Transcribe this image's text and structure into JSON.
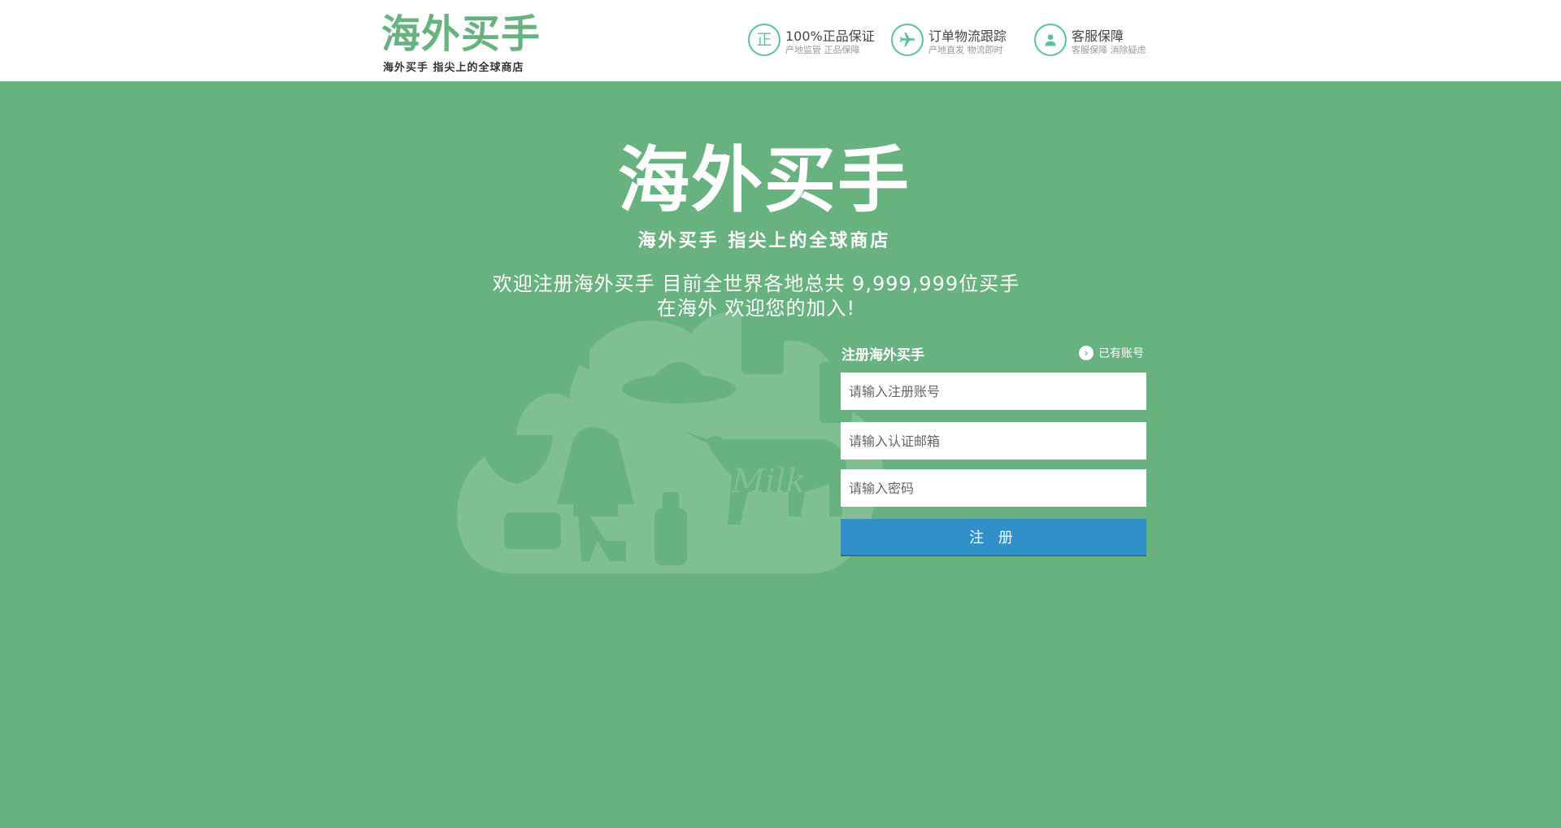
{
  "header": {
    "logo_title": "海外买手",
    "logo_subtitle": "海外买手 指尖上的全球商店",
    "features": [
      {
        "icon": "genuine-icon",
        "icon_text": "正",
        "title": "100%正品保证",
        "subtitle": "产地监管  正品保障"
      },
      {
        "icon": "airplane-icon",
        "title": "订单物流跟踪",
        "subtitle": "产地直发 物流即时"
      },
      {
        "icon": "user-icon",
        "title": "客服保障",
        "subtitle": "客服保障 消除疑虑"
      }
    ]
  },
  "main": {
    "logo_title": "海外买手",
    "logo_subtitle": "海外买手 指尖上的全球商店",
    "welcome_line1": "欢迎注册海外买手 目前全世界各地总共 9,999,999位买手",
    "welcome_line2": "在海外 欢迎您的加入!",
    "cloud_text": "Milk"
  },
  "form": {
    "title": "注册海外买手",
    "login_link": "已有账号",
    "account_placeholder": "请输入注册账号",
    "email_placeholder": "请输入认证邮箱",
    "password_placeholder": "请输入密码",
    "submit_label": "注 册"
  },
  "colors": {
    "brand_green": "#67b27e",
    "icon_teal": "#5cc0a0",
    "button_blue": "#3190c9"
  }
}
